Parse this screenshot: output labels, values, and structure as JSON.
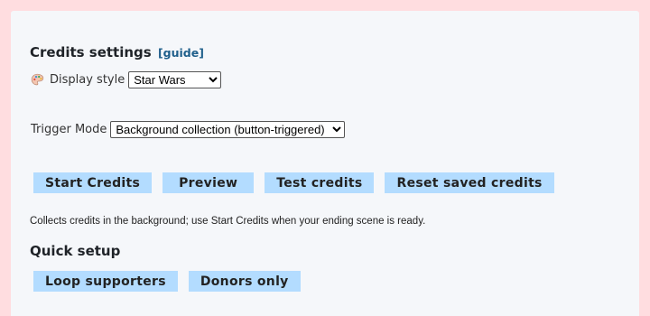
{
  "credits_settings": {
    "title": "Credits settings",
    "guide_link": "[guide]"
  },
  "display_style": {
    "icon": "palette-icon",
    "label": "Display style",
    "selected": "Star Wars"
  },
  "trigger_mode": {
    "label": "Trigger Mode",
    "selected": "Background collection (button-triggered)"
  },
  "actions": {
    "start_credits": "Start Credits",
    "preview": "Preview",
    "test_credits": "Test credits",
    "reset_saved_credits": "Reset saved credits"
  },
  "hint": "Collects credits in the background; use Start Credits when your ending scene is ready.",
  "quick_setup": {
    "title": "Quick setup",
    "loop_supporters": "Loop supporters",
    "donors_only": "Donors only"
  },
  "colors": {
    "page_background": "#ffdde0",
    "panel_background": "#f5f7fa",
    "button_background": "#b3dcff",
    "link_color": "#1f5f8b"
  }
}
